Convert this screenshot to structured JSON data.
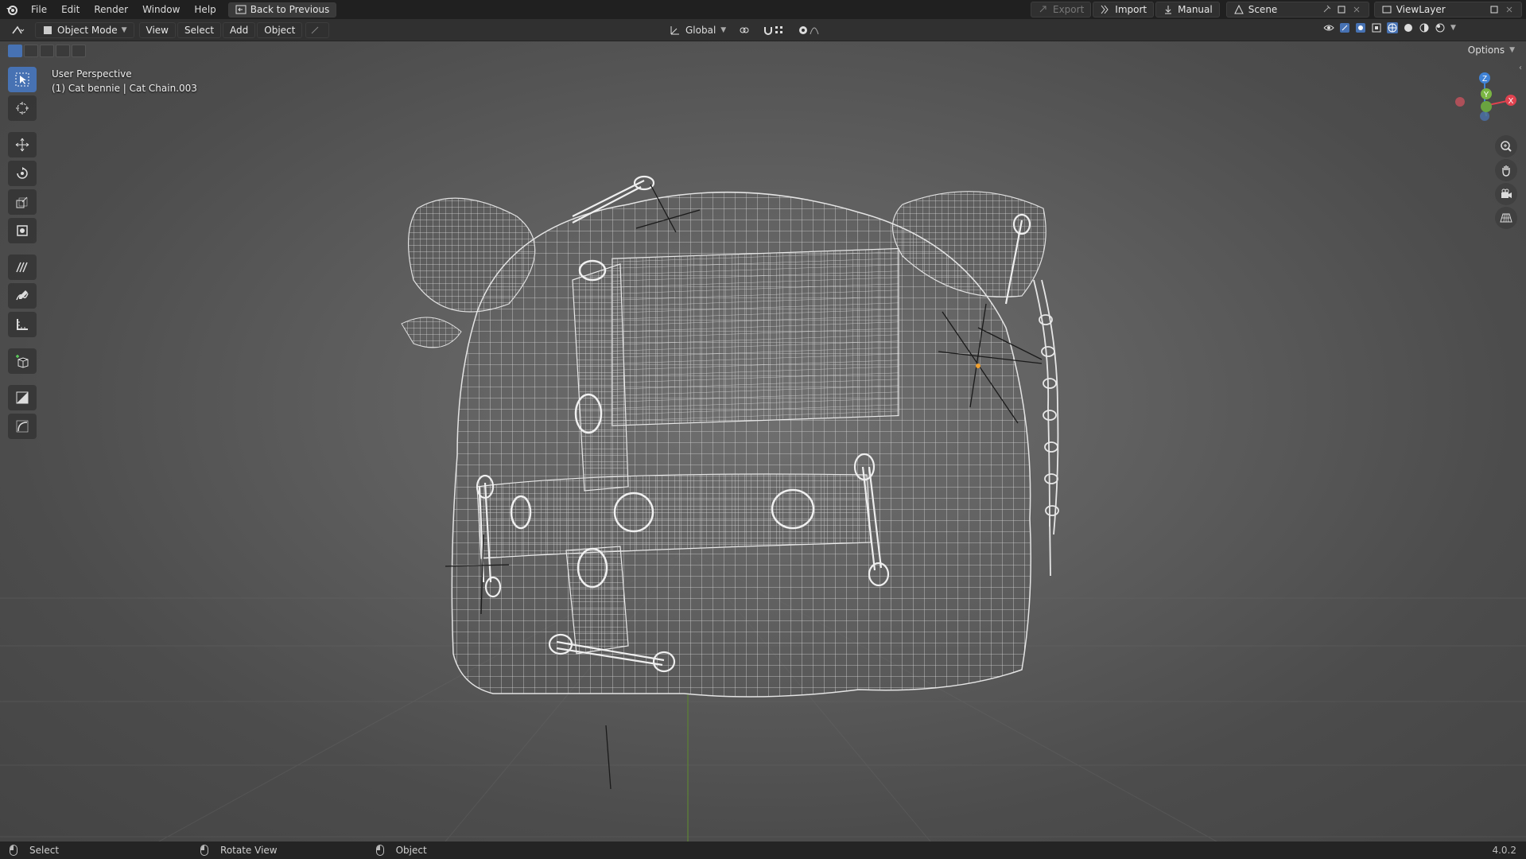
{
  "menu": {
    "items": [
      "File",
      "Edit",
      "Render",
      "Window",
      "Help"
    ],
    "back_button": "Back to Previous"
  },
  "top_right": {
    "export_label": "Export",
    "import_label": "Import",
    "manual_label": "Manual",
    "scene_name": "Scene",
    "view_layer": "ViewLayer"
  },
  "header": {
    "mode": "Object Mode",
    "menus": [
      "View",
      "Select",
      "Add",
      "Object"
    ],
    "transform_orientation": "Global",
    "options_label": "Options"
  },
  "viewport": {
    "perspective_label": "User Perspective",
    "object_info": "(1) Cat bennie | Cat Chain.003",
    "axis_labels": {
      "x": "X",
      "y": "Y",
      "z": "Z"
    }
  },
  "status": {
    "select_label": "Select",
    "rotate_label": "Rotate View",
    "object_label": "Object",
    "version": "4.0.2"
  },
  "colors": {
    "accent": "#4772b3",
    "x_axis": "#e0424f",
    "y_axis": "#7ab543",
    "z_axis": "#3f82d6"
  }
}
